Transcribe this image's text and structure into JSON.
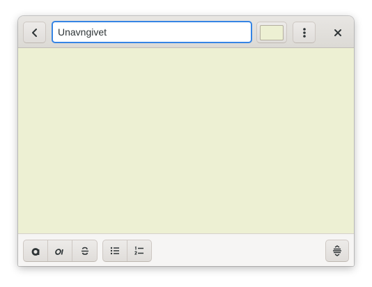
{
  "header": {
    "title_value": "Unavngivet",
    "icons": {
      "back": "go-previous-icon",
      "menu": "view-more-icon",
      "close": "window-close-icon"
    }
  },
  "note": {
    "text": "",
    "background_color": "#edf0d3"
  },
  "colors": {
    "note_color": "#edf0d3",
    "entry_focus": "#3584e4",
    "headerbar": "#dedbd7"
  },
  "bottombar": {
    "format_buttons": [
      "bold-icon",
      "italic-icon",
      "strikethrough-icon"
    ],
    "list_buttons": [
      "bulleted-list-icon",
      "numbered-list-icon"
    ],
    "more_formatting": "formatting-options-icon"
  }
}
